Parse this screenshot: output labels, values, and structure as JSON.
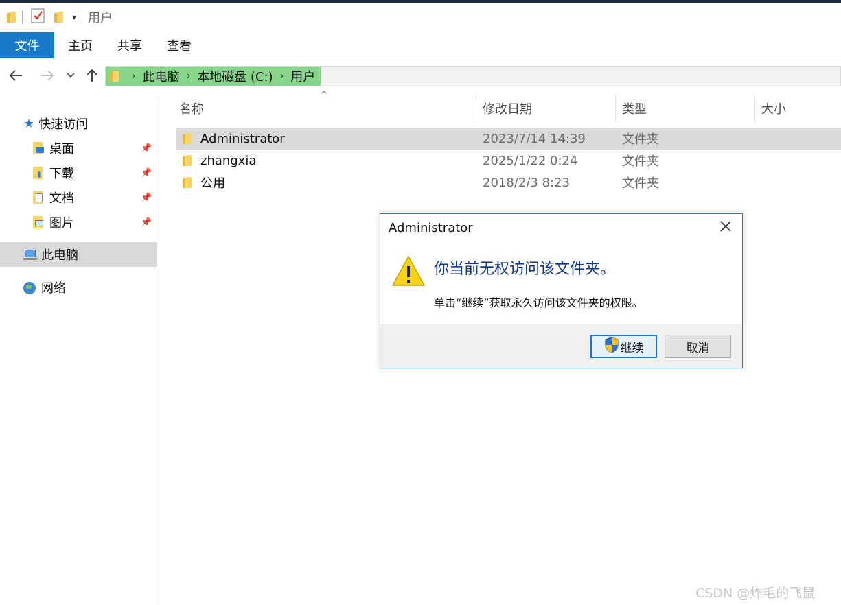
{
  "window": {
    "title": "用户"
  },
  "ribbon": {
    "tabs": [
      "文件",
      "主页",
      "共享",
      "查看"
    ]
  },
  "address": {
    "crumbs": [
      "此电脑",
      "本地磁盘 (C:)",
      "用户"
    ]
  },
  "sidebar": {
    "quick_access": "快速访问",
    "pinned": [
      "桌面",
      "下载",
      "文档",
      "图片"
    ],
    "this_pc": "此电脑",
    "network": "网络"
  },
  "columns": {
    "name": "名称",
    "modified": "修改日期",
    "type": "类型",
    "size": "大小"
  },
  "files": [
    {
      "name": "Administrator",
      "date": "2023/7/14 14:39",
      "type": "文件夹",
      "selected": true
    },
    {
      "name": "zhangxia",
      "date": "2025/1/22 0:24",
      "type": "文件夹",
      "selected": false
    },
    {
      "name": "公用",
      "date": "2018/2/3 8:23",
      "type": "文件夹",
      "selected": false
    }
  ],
  "dialog": {
    "title": "Administrator",
    "main_text": "你当前无权访问该文件夹。",
    "sub_text": "单击“继续”获取永久访问该文件夹的权限。",
    "continue_label": "继续",
    "cancel_label": "取消"
  },
  "watermark": "CSDN @炸毛的飞鼠",
  "colors": {
    "accent": "#1979ca",
    "breadcrumb_highlight": "#86d58a",
    "dialog_heading": "#10398f",
    "folder": "#f8d56a"
  }
}
